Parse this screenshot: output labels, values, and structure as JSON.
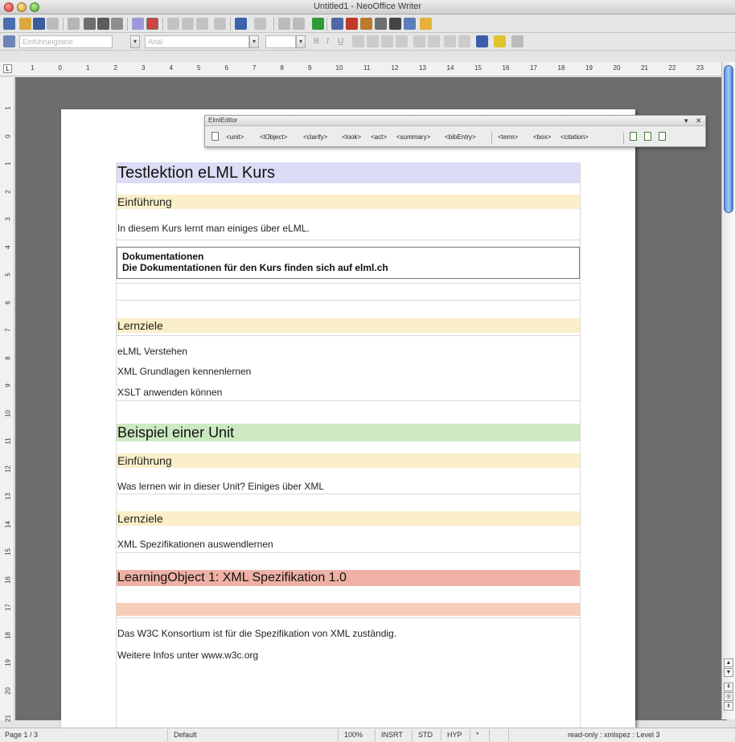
{
  "window": {
    "title": "Untitled1 - NeoOffice Writer"
  },
  "toolbar2": {
    "paragraph_style": "Einführungstext",
    "font_name": "Arial",
    "font_size": ""
  },
  "ruler": {
    "h_ticks": [
      "1",
      "0",
      "1",
      "2",
      "3",
      "4",
      "5",
      "6",
      "7",
      "8",
      "9",
      "10",
      "11",
      "12",
      "13",
      "14",
      "15",
      "16",
      "17",
      "18",
      "19",
      "20",
      "21",
      "22",
      "23"
    ],
    "v_ticks": [
      "1",
      "0",
      "1",
      "2",
      "3",
      "4",
      "5",
      "6",
      "7",
      "8",
      "9",
      "10",
      "11",
      "12",
      "13",
      "14",
      "15",
      "16",
      "17",
      "18",
      "19",
      "20",
      "21"
    ]
  },
  "elml_editor": {
    "title": "ElmlEditor",
    "items": [
      "<unit>",
      "<lObject>",
      "<clarify>",
      "<look>",
      "<act>",
      "<summary>",
      "<bibEntry>",
      "<term>",
      "<box>",
      "<citation>"
    ]
  },
  "document": {
    "title": "Testlektion eLML Kurs",
    "intro_heading": "Einführung",
    "intro_text": "In diesem Kurs lernt man einiges über eLML.",
    "box_title": "Dokumentationen",
    "box_text": "Die Dokumentationen für den Kurs finden sich auf elml.ch",
    "goals_heading": "Lernziele",
    "goals": [
      "eLML Verstehen",
      "XML Grundlagen kennenlernen",
      "XSLT anwenden können"
    ],
    "unit_title": "Beispiel einer Unit",
    "unit_intro_heading": "Einführung",
    "unit_intro_text": "Was lernen wir in dieser Unit? Einiges über XML",
    "unit_goals_heading": "Lernziele",
    "unit_goals_text": "XML Spezifikationen auswendlernen",
    "lo_title": "LearningObject 1: XML Spezifikation 1.0",
    "lo_text1": "Das W3C Konsortium ist für die Spezifikation von XML zuständig.",
    "lo_text2": "Weitere Infos unter www.w3c.org"
  },
  "status": {
    "page": "Page 1 / 3",
    "style": "Default",
    "zoom": "100%",
    "insert_mode": "INSRT",
    "selection_mode": "STD",
    "hyphen": "HYP",
    "modified": "*",
    "info": "read-only : xmlspez : Level 3"
  }
}
